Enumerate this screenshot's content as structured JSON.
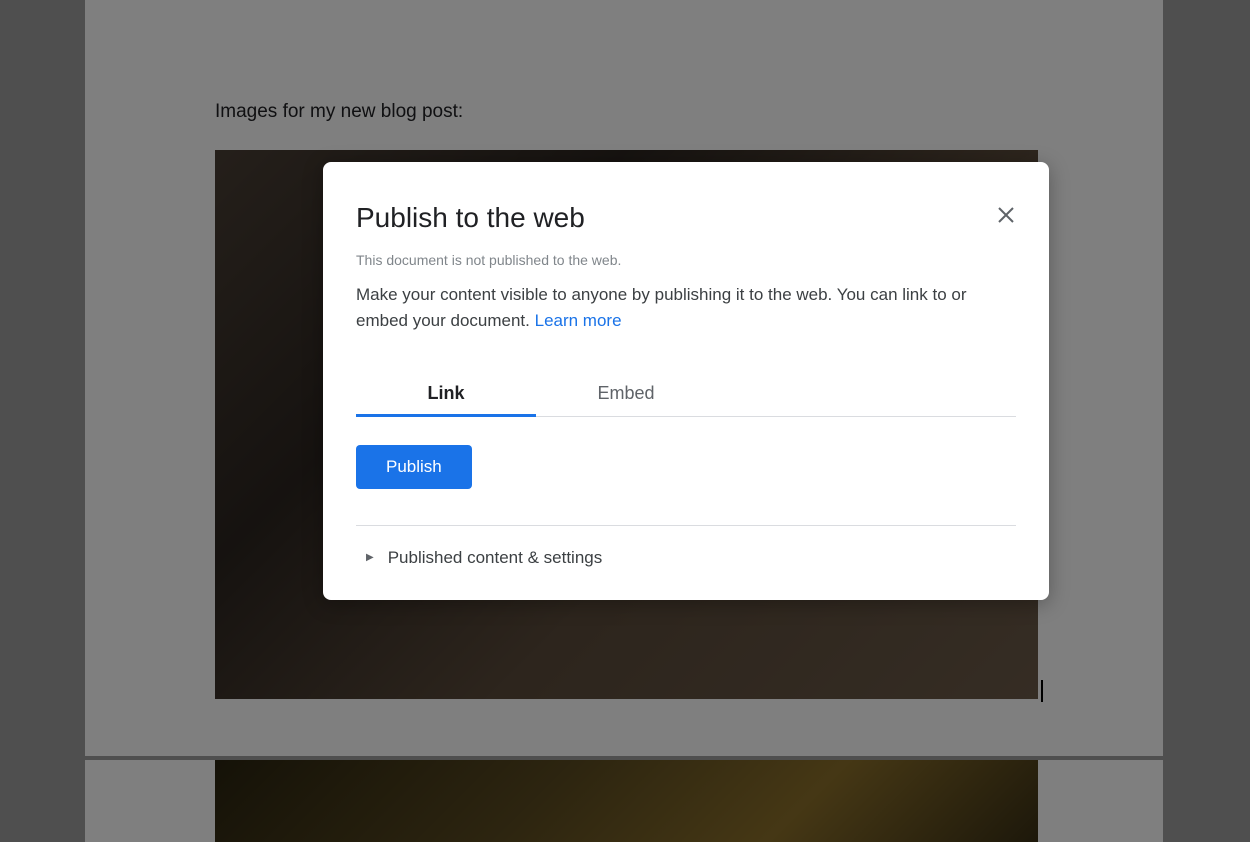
{
  "document": {
    "body_text": "Images for my new blog post:"
  },
  "modal": {
    "title": "Publish to the web",
    "status": "This document is not published to the web.",
    "description": "Make your content visible to anyone by publishing it to the web. You can link to or embed your document. ",
    "learn_more": "Learn more",
    "tabs": {
      "link": "Link",
      "embed": "Embed"
    },
    "publish_button": "Publish",
    "expandable_section": "Published content & settings"
  }
}
